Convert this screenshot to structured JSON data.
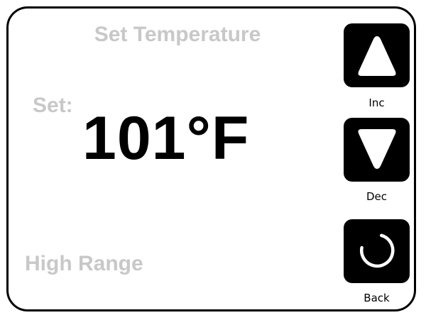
{
  "screen": {
    "title": "Set Temperature",
    "set_label": "Set:",
    "temperature_value": "101°F",
    "range_label": "High Range"
  },
  "buttons": {
    "inc": {
      "label": "Inc",
      "icon": "triangle-up-icon"
    },
    "dec": {
      "label": "Dec",
      "icon": "triangle-down-icon"
    },
    "back": {
      "label": "Back",
      "icon": "circular-arrow-icon"
    }
  },
  "colors": {
    "frame": "#000000",
    "muted_text": "#c8c8c8",
    "value_text": "#000000",
    "button_bg": "#000000",
    "button_icon": "#ffffff"
  }
}
